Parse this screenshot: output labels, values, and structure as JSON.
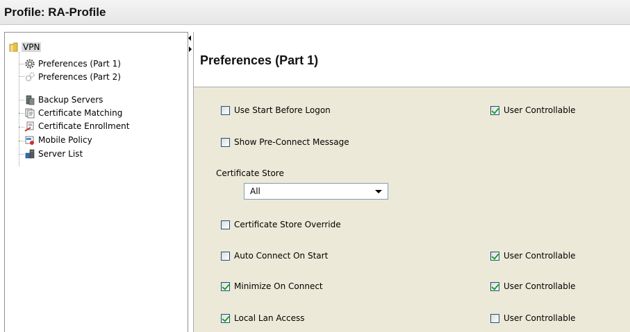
{
  "title": "Profile:  RA-Profile",
  "tree": {
    "root": "VPN",
    "items": [
      {
        "label": "Preferences (Part 1)",
        "icon": "gear-icon"
      },
      {
        "label": "Preferences (Part 2)",
        "icon": "gears-small-icon"
      },
      {
        "label": "Backup Servers",
        "icon": "server-icon"
      },
      {
        "label": "Certificate Matching",
        "icon": "certificate-icon"
      },
      {
        "label": "Certificate Enrollment",
        "icon": "certificate-pen-icon"
      },
      {
        "label": "Mobile Policy",
        "icon": "mobile-policy-icon"
      },
      {
        "label": "Server List",
        "icon": "server-list-icon"
      }
    ]
  },
  "panel": {
    "header": "Preferences (Part 1)",
    "options": [
      {
        "label": "Use Start Before Logon",
        "checked": false,
        "user_controllable": true
      },
      {
        "label": "Show Pre-Connect Message",
        "checked": false,
        "user_controllable": null
      },
      {
        "label": "Certificate Store Override",
        "checked": false,
        "user_controllable": null
      },
      {
        "label": "Auto Connect On Start",
        "checked": false,
        "user_controllable": true
      },
      {
        "label": "Minimize On Connect",
        "checked": true,
        "user_controllable": true
      },
      {
        "label": "Local Lan Access",
        "checked": true,
        "user_controllable": false
      }
    ],
    "user_controllable_label": "User Controllable",
    "certificate_store": {
      "label": "Certificate Store",
      "value": "All"
    }
  },
  "colors": {
    "content_bg": "#ece9d8",
    "checkbox_border": "#1c5180",
    "check_mark": "#21a121"
  }
}
